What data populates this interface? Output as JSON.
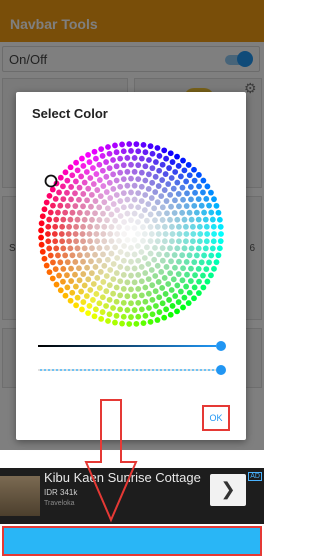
{
  "app_bar": {
    "title": "Navbar Tools"
  },
  "toggle": {
    "label": "On/Off",
    "state": "on"
  },
  "background_cards": {
    "visible_letters": [
      "S",
      "6"
    ]
  },
  "dialog": {
    "title": "Select Color",
    "color_wheel": {
      "icon": "color-wheel-icon",
      "selected": "blue"
    },
    "brightness_slider": {
      "value": 1.0
    },
    "alpha_slider": {
      "value": 1.0
    },
    "ok_label": "OK"
  },
  "ad": {
    "title": "Kibu Kaen Sunrise Cottage",
    "price": "IDR 341k",
    "subtext": "Traveloka",
    "badge": "AD",
    "arrow_icon": "chevron-right-icon"
  },
  "colors": {
    "app_bar": "#f39c12",
    "accent": "#2196f3",
    "highlight": "#e53935",
    "navbar_preview": "#29b6f6"
  }
}
